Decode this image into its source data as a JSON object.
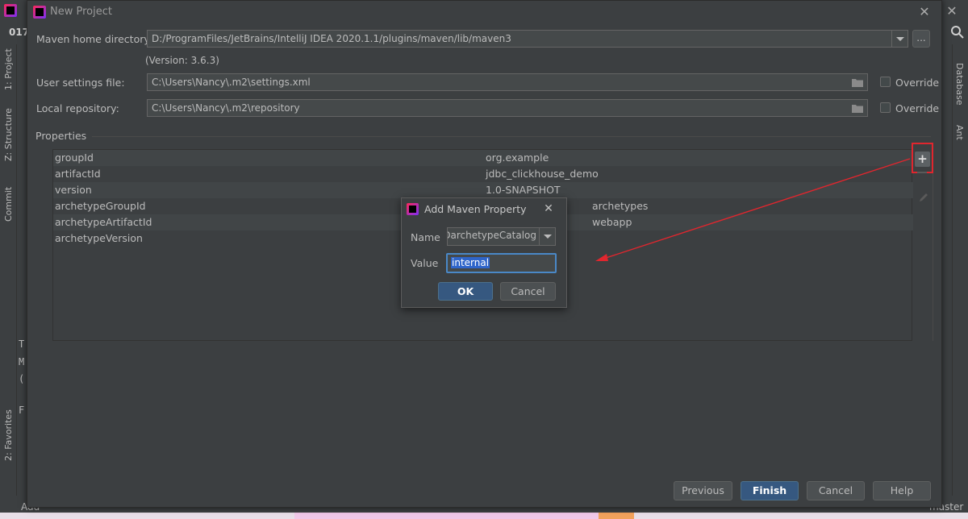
{
  "ide": {
    "project_num": "017",
    "left_tabs": [
      "1: Project",
      "Z: Structure",
      "Commit",
      "2: Favorites"
    ],
    "right_tabs": [
      "Database",
      "Ant"
    ],
    "bottom_left": "Add",
    "branch": "master"
  },
  "dialog": {
    "title": "New Project",
    "maven_home_label": "Maven home directory:",
    "maven_home_value": "D:/ProgramFiles/JetBrains/IntelliJ IDEA 2020.1.1/plugins/maven/lib/maven3",
    "maven_version": "(Version: 3.6.3)",
    "browse_label": "...",
    "user_settings_label": "User settings file:",
    "user_settings_value": "C:\\Users\\Nancy\\.m2\\settings.xml",
    "local_repo_label": "Local repository:",
    "local_repo_value": "C:\\Users\\Nancy\\.m2\\repository",
    "override_label": "Override",
    "properties_label": "Properties",
    "properties": [
      {
        "key": "groupId",
        "value": "org.example"
      },
      {
        "key": "artifactId",
        "value": "jdbc_clickhouse_demo"
      },
      {
        "key": "version",
        "value": "1.0-SNAPSHOT"
      },
      {
        "key": "archetypeGroupId",
        "value": "archetypes"
      },
      {
        "key": "archetypeArtifactId",
        "value": "webapp"
      },
      {
        "key": "archetypeVersion",
        "value": ""
      }
    ],
    "add_label": "+",
    "buttons": {
      "previous": "Previous",
      "finish": "Finish",
      "cancel": "Cancel",
      "help": "Help"
    }
  },
  "popup": {
    "title": "Add Maven Property",
    "name_label": "Name",
    "name_value": "DarchetypeCatalog",
    "value_label": "Value",
    "value_value": "internal",
    "ok": "OK",
    "cancel": "Cancel"
  },
  "colors": {
    "background": "#3c3f41",
    "accent_button": "#365880",
    "highlight": "#e0262e"
  }
}
